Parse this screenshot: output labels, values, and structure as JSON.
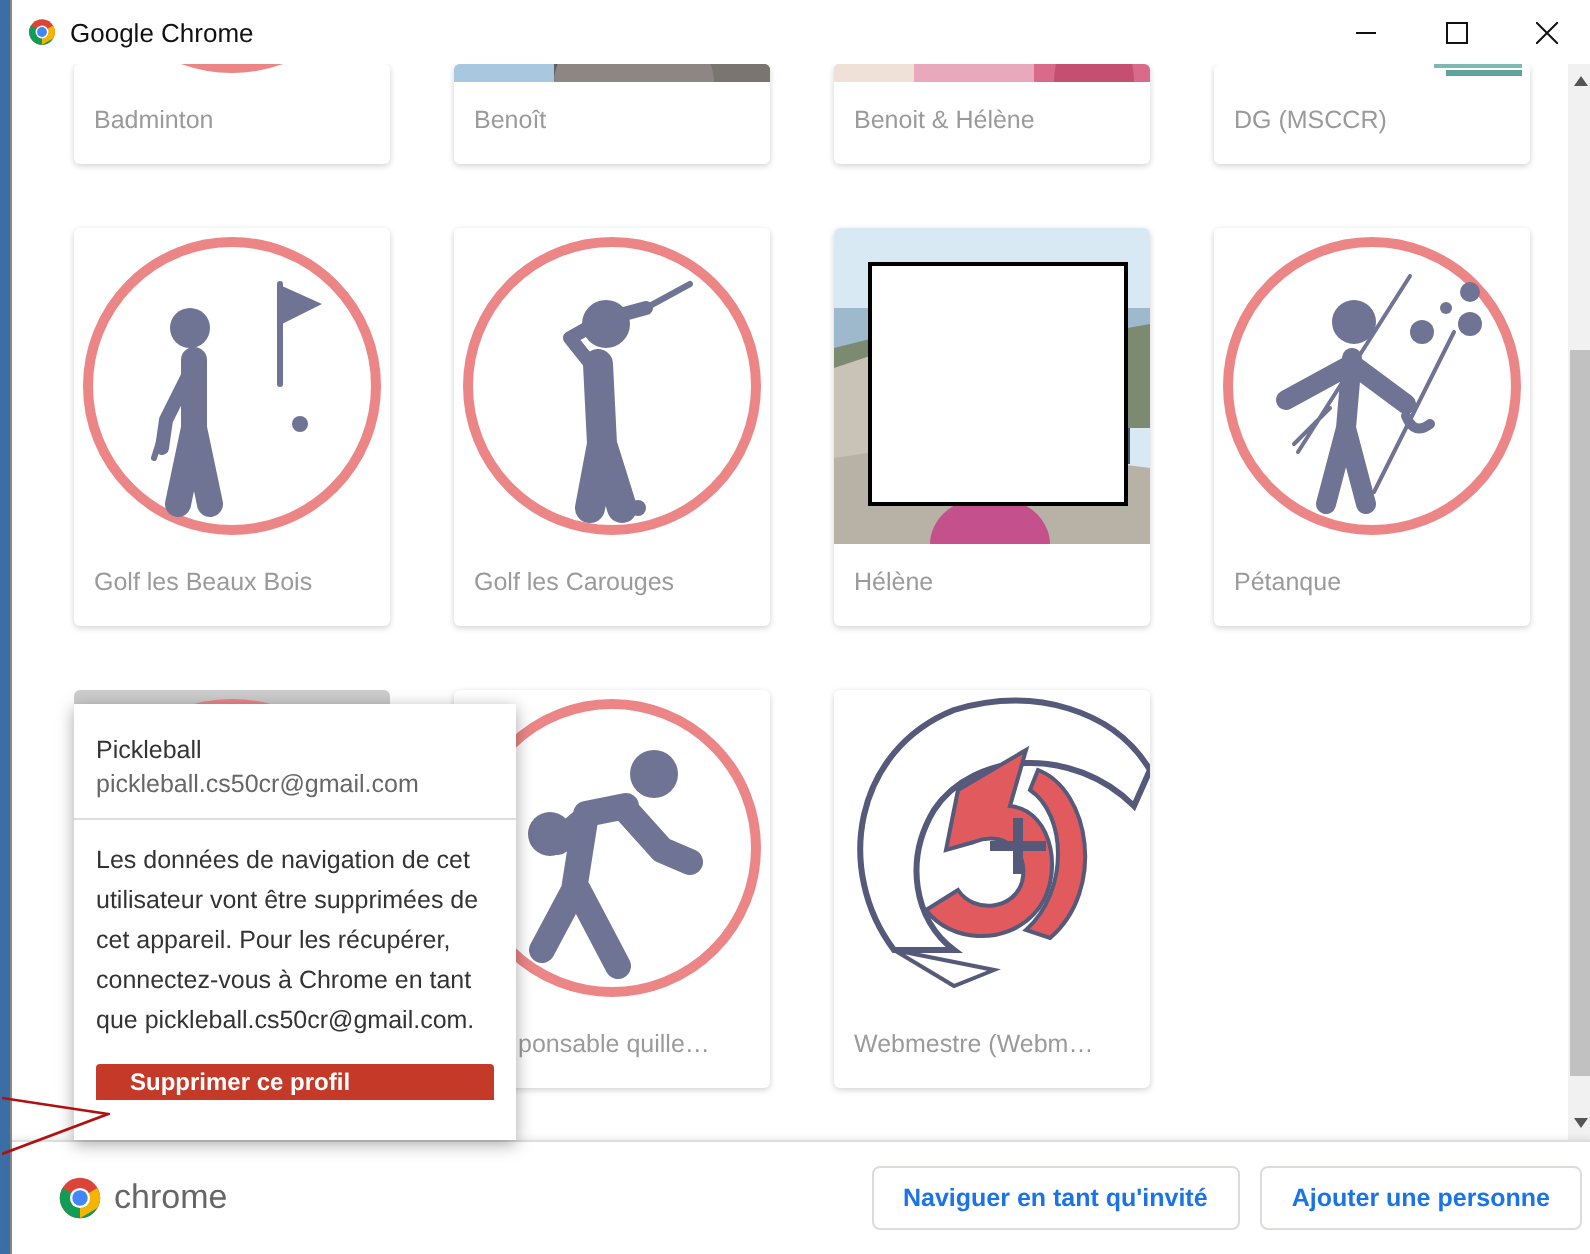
{
  "window": {
    "title": "Google Chrome"
  },
  "profiles": [
    {
      "kind": "badminton",
      "label": "Badminton",
      "top_cut_off": true,
      "selected": false
    },
    {
      "kind": "picture",
      "label": "Benoît",
      "top_cut_off": true,
      "selected": false
    },
    {
      "kind": "picture",
      "label": "Benoit & Hélène",
      "top_cut_off": true,
      "selected": false
    },
    {
      "kind": "picture",
      "label": "DG (MSCCR)",
      "top_cut_off": true,
      "selected": false
    },
    {
      "kind": "golf-flag",
      "label": "Golf les Beaux Bois",
      "selected": false
    },
    {
      "kind": "golf-swing",
      "label": "Golf les Carouges",
      "selected": false
    },
    {
      "kind": "picture",
      "label": "Hélène",
      "selected": false
    },
    {
      "kind": "petanque",
      "label": "Pétanque",
      "selected": false
    },
    {
      "kind": "badminton",
      "bottom_hidden": true,
      "selected": true
    },
    {
      "kind": "bowling",
      "label": "ponsable quille…",
      "partly_covered": true,
      "selected": false
    },
    {
      "kind": "club-logo",
      "label": "Webmestre (Webm…",
      "selected": false
    }
  ],
  "popup": {
    "name": "Pickleball",
    "email": "pickleball.cs50cr@gmail.com",
    "message": "Les données de navigation de cet utilisateur vont être supprimées de cet appareil. Pour les récupérer, connectez-vous à Chrome en tant que pickleball.cs50cr@gmail.com.",
    "button": "Supprimer ce profil"
  },
  "footer": {
    "brand": "chrome",
    "buttons": [
      "Naviguer en tant qu'invité",
      "Ajouter une personne"
    ]
  }
}
